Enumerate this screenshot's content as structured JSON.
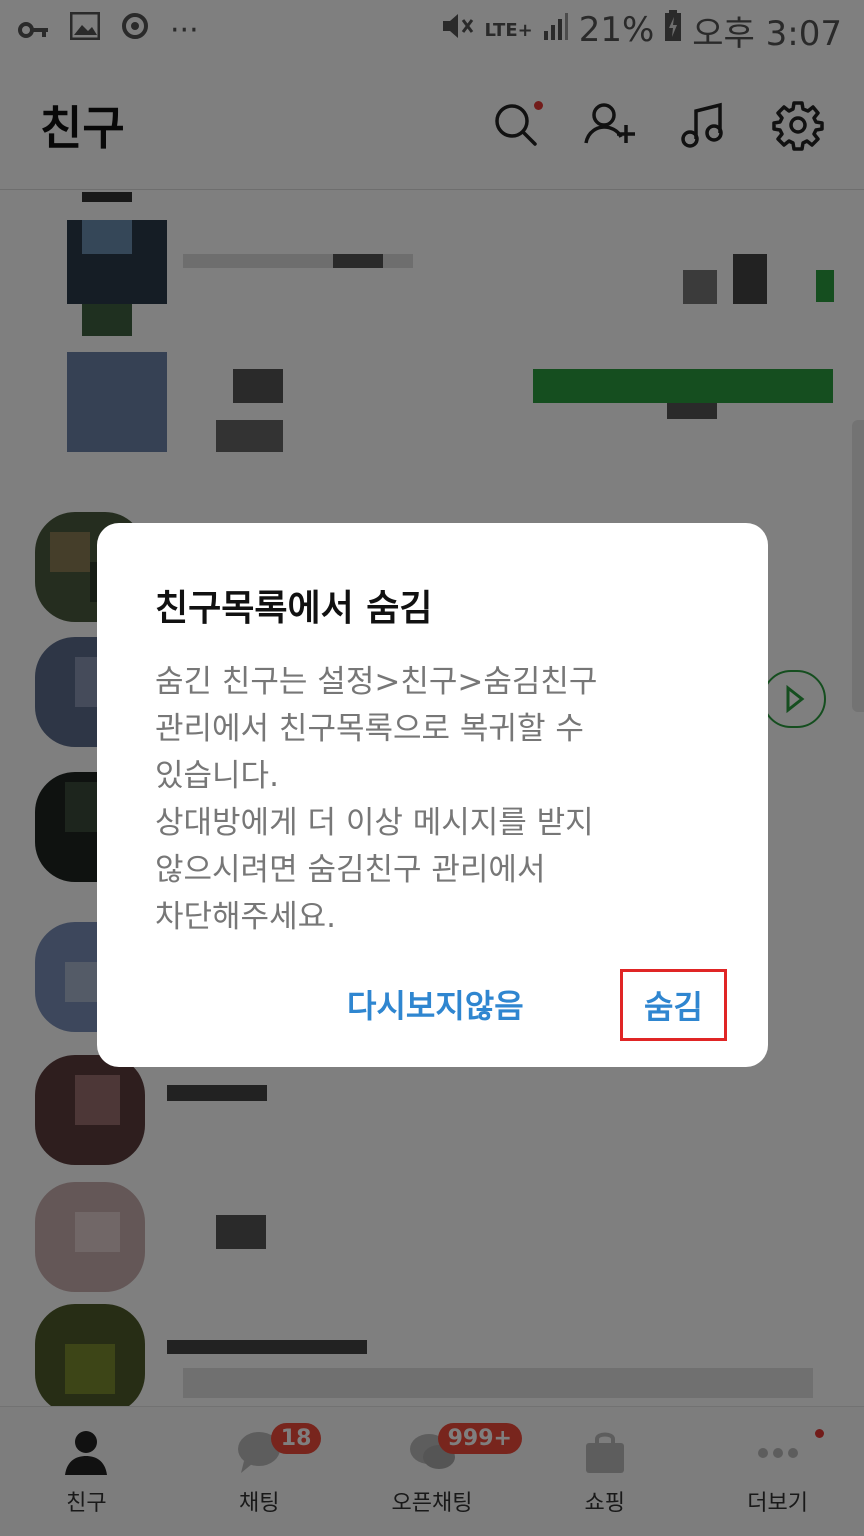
{
  "status_bar": {
    "battery": "21%",
    "time": "오후 3:07",
    "network": "LTE+",
    "icons": [
      "key-icon",
      "image-icon",
      "sync-icon",
      "more-dots-icon",
      "mute-icon",
      "signal-icon",
      "battery-icon"
    ]
  },
  "header": {
    "title": "친구",
    "icons": [
      "search-icon",
      "add-friend-icon",
      "music-icon",
      "settings-icon"
    ]
  },
  "dialog": {
    "title": "친구목록에서 숨김",
    "body": "숨긴 친구는 설정>친구>숨김친구\n관리에서 친구목록으로 복귀할 수\n있습니다.\n상대방에게 더 이상 메시지를 받지\n않으시려면 숨김친구 관리에서\n차단해주세요.",
    "dont_show_label": "다시보지않음",
    "hide_label": "숨김"
  },
  "bottom_nav": {
    "items": [
      {
        "label": "친구",
        "icon": "person-icon"
      },
      {
        "label": "채팅",
        "icon": "chat-icon",
        "badge": "18"
      },
      {
        "label": "오픈채팅",
        "icon": "open-chat-icon",
        "badge": "999+"
      },
      {
        "label": "쇼핑",
        "icon": "shopping-bag-icon"
      },
      {
        "label": "더보기",
        "icon": "more-icon"
      }
    ]
  },
  "colors": {
    "accent_blue": "#2f86d0",
    "highlight_red": "#e02525",
    "badge_red": "#f04a3a",
    "green": "#2a9d3f"
  }
}
